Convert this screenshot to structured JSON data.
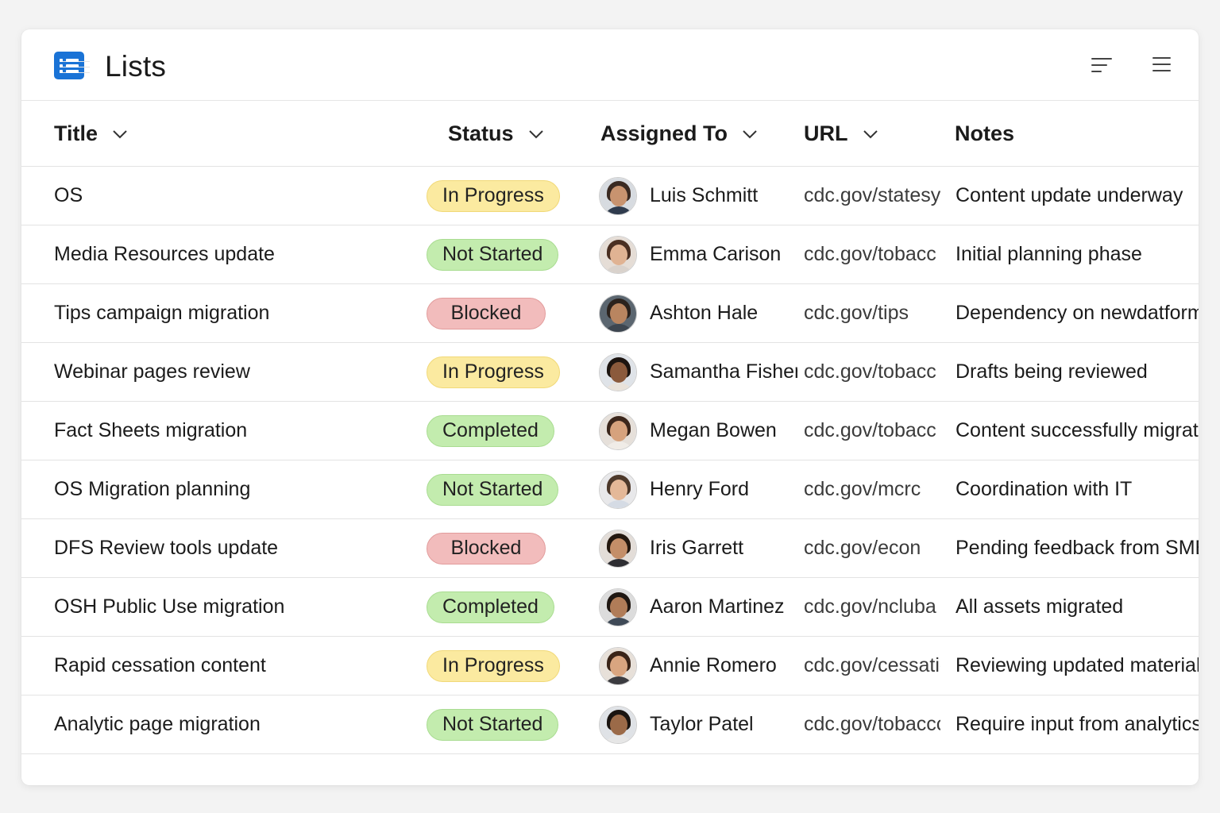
{
  "app": {
    "title": "Lists",
    "logo_icon": "list-app-icon",
    "accent": "#1a73d6"
  },
  "toolbar": {
    "sort_icon": "sort-lines-icon",
    "menu_icon": "hamburger-menu-icon"
  },
  "columns": [
    {
      "key": "title",
      "label": "Title",
      "has_dropdown": true
    },
    {
      "key": "status",
      "label": "Status",
      "has_dropdown": true
    },
    {
      "key": "assigned",
      "label": "Assigned To",
      "has_dropdown": true
    },
    {
      "key": "url",
      "label": "URL",
      "has_dropdown": true
    },
    {
      "key": "notes",
      "label": "Notes",
      "has_dropdown": false
    }
  ],
  "status_colors": {
    "In Progress": "#fbeaa0",
    "Not Started": "#c3ecae",
    "Blocked": "#f2bcbc",
    "Completed": "#c3ecae"
  },
  "rows": [
    {
      "title": "OS",
      "status": "In Progress",
      "assigned": "Luis Schmitt",
      "url": "cdc.gov/statesy",
      "notes": "Content update underway"
    },
    {
      "title": "Media Resources update",
      "status": "Not Started",
      "assigned": "Emma Carison",
      "url": "cdc.gov/tobacc",
      "notes": "Initial planning phase"
    },
    {
      "title": "Tips campaign migration",
      "status": "Blocked",
      "assigned": "Ashton Hale",
      "url": "cdc.gov/tips",
      "notes": "Dependency on newdatform"
    },
    {
      "title": "Webinar pages review",
      "status": "In Progress",
      "assigned": "Samantha Fisher",
      "url": "cdc.gov/tobacc",
      "notes": "Drafts being reviewed"
    },
    {
      "title": "Fact Sheets migration",
      "status": "Completed",
      "assigned": "Megan Bowen",
      "url": "cdc.gov/tobacc",
      "notes": "Content successfully migrate"
    },
    {
      "title": "OS Migration planning",
      "status": "Not Started",
      "assigned": "Henry Ford",
      "url": "cdc.gov/mcrc",
      "notes": "Coordination with IT"
    },
    {
      "title": "DFS Review tools update",
      "status": "Blocked",
      "assigned": "Iris Garrett",
      "url": "cdc.gov/econ",
      "notes": "Pending feedback from SMEs"
    },
    {
      "title": "OSH Public Use migration",
      "status": "Completed",
      "assigned": "Aaron Martinez",
      "url": "cdc.gov/ncluba",
      "notes": "All assets migrated"
    },
    {
      "title": "Rapid cessation content",
      "status": "In Progress",
      "assigned": "Annie Romero",
      "url": "cdc.gov/cessatic",
      "notes": "Reviewing updated material"
    },
    {
      "title": "Analytic page migration",
      "status": "Not Started",
      "assigned": "Taylor Patel",
      "url": "cdc.gov/tobaccc",
      "notes": "Require input from analytics"
    }
  ]
}
